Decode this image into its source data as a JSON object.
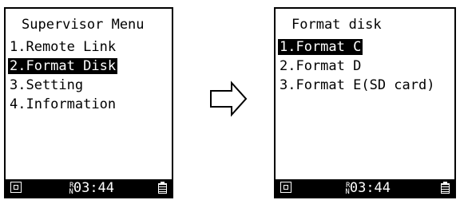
{
  "left_screen": {
    "title": "Supervisor Menu",
    "items": [
      "1.Remote Link",
      "2.Format Disk",
      "3.Setting",
      "4.Information"
    ],
    "selected_index": 1,
    "status_time": "03:44",
    "status_superscript": "R",
    "status_subscript": "N"
  },
  "right_screen": {
    "title": "Format disk",
    "items": [
      "1.Format C",
      "2.Format D",
      "3.Format E(SD card)"
    ],
    "selected_index": 0,
    "status_time": "03:44",
    "status_superscript": "R",
    "status_subscript": "N"
  },
  "icons": {
    "transition": "arrow-right-icon",
    "status_left": "signal-icon",
    "status_right": "battery-icon"
  }
}
